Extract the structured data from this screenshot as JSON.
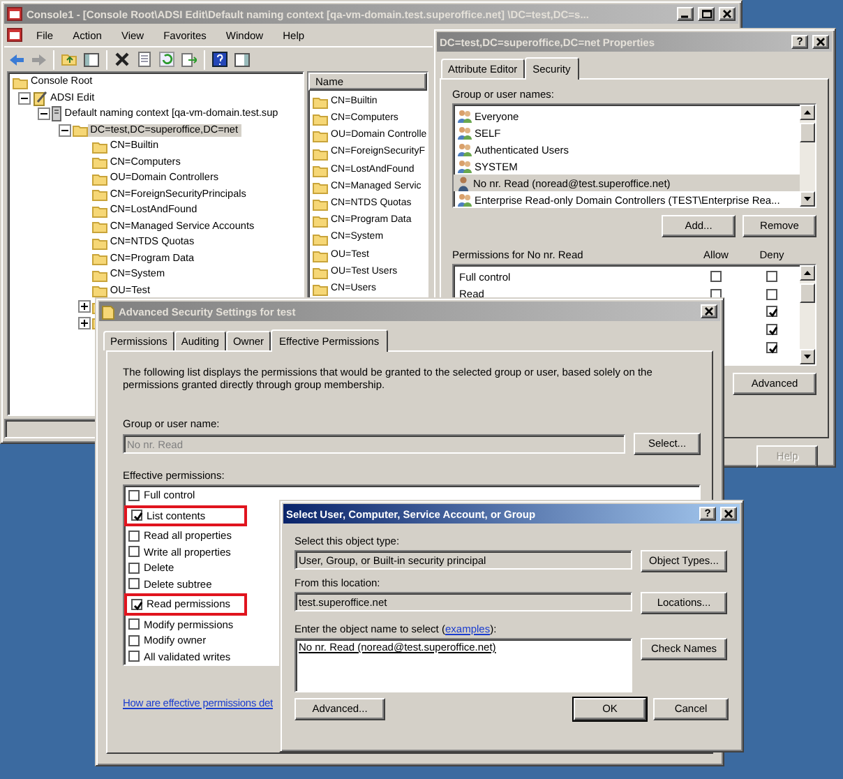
{
  "console": {
    "title": "Console1 - [Console Root\\ADSI Edit\\Default naming context [qa-vm-domain.test.superoffice.net] \\DC=test,DC=s...",
    "menu": [
      "File",
      "Action",
      "View",
      "Favorites",
      "Window",
      "Help"
    ],
    "tree": [
      {
        "label": "Console Root",
        "kind": "folder",
        "selected": false,
        "children": [
          {
            "label": "ADSI Edit",
            "kind": "tool",
            "expanded": true,
            "selected": false,
            "children": [
              {
                "label": "Default naming context [qa-vm-domain.test.sup",
                "kind": "server",
                "expanded": true,
                "selected": false,
                "children": [
                  {
                    "label": "DC=test,DC=superoffice,DC=net",
                    "kind": "folder",
                    "expanded": true,
                    "selected": true,
                    "children": [
                      {
                        "label": "CN=Builtin",
                        "kind": "folder",
                        "selected": false
                      },
                      {
                        "label": "CN=Computers",
                        "kind": "folder",
                        "selected": false
                      },
                      {
                        "label": "OU=Domain Controllers",
                        "kind": "folder",
                        "selected": false
                      },
                      {
                        "label": "CN=ForeignSecurityPrincipals",
                        "kind": "folder",
                        "selected": false
                      },
                      {
                        "label": "CN=LostAndFound",
                        "kind": "folder",
                        "selected": false
                      },
                      {
                        "label": "CN=Managed Service Accounts",
                        "kind": "folder",
                        "selected": false
                      },
                      {
                        "label": "CN=NTDS Quotas",
                        "kind": "folder",
                        "selected": false
                      },
                      {
                        "label": "CN=Program Data",
                        "kind": "folder",
                        "selected": false
                      },
                      {
                        "label": "CN=System",
                        "kind": "folder",
                        "selected": false
                      },
                      {
                        "label": "OU=Test",
                        "kind": "folder",
                        "selected": false
                      },
                      {
                        "kind": "folder",
                        "expanded": false
                      },
                      {
                        "kind": "folder",
                        "expanded": false
                      }
                    ]
                  }
                ]
              }
            ]
          }
        ]
      }
    ],
    "list": {
      "column": "Name",
      "items": [
        "CN=Builtin",
        "CN=Computers",
        "OU=Domain Controlle",
        "CN=ForeignSecurityF",
        "CN=LostAndFound",
        "CN=Managed Servic",
        "CN=NTDS Quotas",
        "CN=Program Data",
        "CN=System",
        "OU=Test",
        "OU=Test Users",
        "CN=Users"
      ]
    }
  },
  "properties": {
    "title": "DC=test,DC=superoffice,DC=net Properties",
    "help_key": "?",
    "tabs": [
      {
        "label": "Attribute Editor",
        "selected": false
      },
      {
        "label": "Security",
        "selected": true
      }
    ],
    "group_label": "Group or user names:",
    "principals": [
      {
        "name": "Everyone",
        "kind": "group",
        "selected": false
      },
      {
        "name": "SELF",
        "kind": "group",
        "selected": false
      },
      {
        "name": "Authenticated Users",
        "kind": "group",
        "selected": false
      },
      {
        "name": "SYSTEM",
        "kind": "group",
        "selected": false
      },
      {
        "name": "No nr. Read (noread@test.superoffice.net)",
        "kind": "user",
        "selected": true
      },
      {
        "name": "Enterprise Read-only Domain Controllers (TEST\\Enterprise Rea...",
        "kind": "group",
        "selected": false
      }
    ],
    "buttons": [
      "Add...",
      "Remove"
    ],
    "permissions_label": "Permissions for No nr. Read",
    "allow_header": "Allow",
    "deny_header": "Deny",
    "permissions": [
      {
        "name": "Full control",
        "allow": false,
        "deny": false
      },
      {
        "name": "Read",
        "allow": false,
        "deny": false
      },
      {
        "deny": true
      },
      {
        "deny": true
      },
      {
        "deny": true
      }
    ],
    "advanced_button": "Advanced",
    "help_button": {
      "label": "Help",
      "disabled": true
    }
  },
  "advanced": {
    "title": "Advanced Security Settings for test",
    "tabs": [
      {
        "label": "Permissions",
        "selected": false
      },
      {
        "label": "Auditing",
        "selected": false
      },
      {
        "label": "Owner",
        "selected": false
      },
      {
        "label": "Effective Permissions",
        "selected": true
      }
    ],
    "description": "The following list displays the permissions that would be granted to the selected group or user, based solely on the permissions granted directly through group membership.",
    "group_label": "Group or user name:",
    "group_field": {
      "value": "No nr. Read",
      "disabled": true
    },
    "select_button": "Select...",
    "permissions_label": "Effective permissions:",
    "permissions": [
      {
        "name": "Full control",
        "checked": false,
        "highlighted": false
      },
      {
        "name": "List contents",
        "checked": true,
        "highlighted": true
      },
      {
        "name": "Read all properties",
        "checked": false,
        "highlighted": false
      },
      {
        "name": "Write all properties",
        "checked": false,
        "highlighted": false
      },
      {
        "name": "Delete",
        "checked": false,
        "highlighted": false
      },
      {
        "name": "Delete subtree",
        "checked": false,
        "highlighted": false
      },
      {
        "name": "Read permissions",
        "checked": true,
        "highlighted": true
      },
      {
        "name": "Modify permissions",
        "checked": false,
        "highlighted": false
      },
      {
        "name": "Modify owner",
        "checked": false,
        "highlighted": false
      },
      {
        "name": "All validated writes",
        "checked": false,
        "highlighted": false
      }
    ],
    "link": "How are effective permissions det"
  },
  "select_dialog": {
    "title": "Select User, Computer, Service Account, or Group",
    "help_key": "?",
    "type_label": "Select this object type:",
    "type_value": "User, Group, or Built-in security principal",
    "type_button": "Object Types...",
    "location_label": "From this location:",
    "location_value": "test.superoffice.net",
    "location_button": "Locations...",
    "name_label": "Enter the object name to select (",
    "name_link": "examples",
    "name_label_end": "):",
    "name_value": "No nr. Read (noread@test.superoffice.net)",
    "check_button": "Check Names",
    "advanced_button": "Advanced...",
    "ok_button": "OK",
    "cancel_button": "Cancel"
  }
}
